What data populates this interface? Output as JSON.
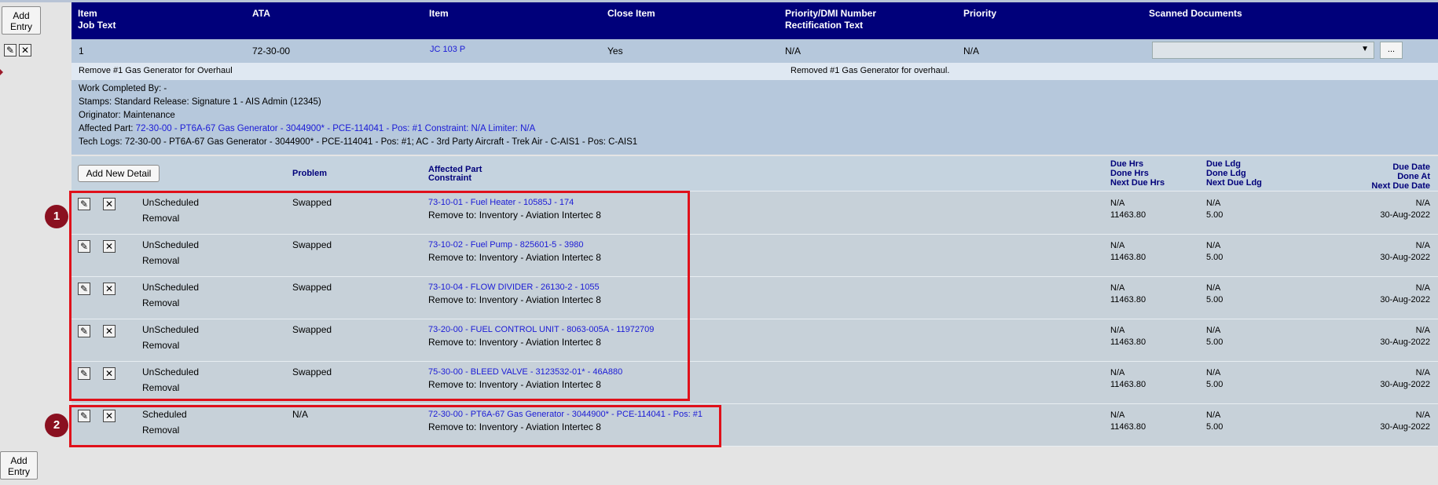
{
  "buttons": {
    "add_entry": "Add Entry",
    "add_new_detail": "Add New Detail",
    "more": "..."
  },
  "header": {
    "item": "Item",
    "job_text": "Job Text",
    "ata": "ATA",
    "item2": "Item",
    "close_item": "Close Item",
    "priority_dmi": "Priority/DMI Number",
    "rectification": "Rectification Text",
    "priority": "Priority",
    "scanned_docs": "Scanned Documents"
  },
  "item": {
    "number": "1",
    "ata": "72-30-00",
    "item_link": "JC 103 P",
    "close_item": "Yes",
    "priority_dmi": "N/A",
    "priority": "N/A",
    "job_text": "Remove #1 Gas Generator for Overhaul",
    "rectification_text": "Removed #1 Gas Generator for overhaul.",
    "work_completed": "Work Completed By: -",
    "stamps": "Stamps: Standard Release: Signature 1 - AIS Admin (12345)",
    "originator": "Originator: Maintenance",
    "affected_part_label": "Affected Part:",
    "affected_part_value": "72-30-00 - PT6A-67 Gas Generator - 3044900* - PCE-114041 - Pos: #1 Constraint: N/A Limiter: N/A",
    "tech_logs": "Tech Logs: 72-30-00 - PT6A-67 Gas Generator - 3044900* - PCE-114041 - Pos: #1; AC - 3rd Party Aircraft - Trek Air - C-AIS1 - Pos: C-AIS1"
  },
  "detail_header": {
    "problem": "Problem",
    "affected_part": "Affected Part",
    "constraint": "Constraint",
    "due_hrs": "Due Hrs",
    "done_hrs": "Done Hrs",
    "next_due_hrs": "Next Due Hrs",
    "due_ldg": "Due Ldg",
    "done_ldg": "Done Ldg",
    "next_due_ldg": "Next Due Ldg",
    "due_date": "Due Date",
    "done_at": "Done At",
    "next_due_date": "Next Due Date"
  },
  "details": [
    {
      "type": "UnScheduled",
      "action": "Removal",
      "problem": "Swapped",
      "part": "73-10-01 - Fuel Heater - 10585J - 174",
      "remove_to": "Remove to: Inventory - Aviation Intertec 8",
      "due_hrs": "N/A",
      "done_hrs": "11463.80",
      "due_ldg": "N/A",
      "done_ldg": "5.00",
      "due_date": "N/A",
      "done_at": "30-Aug-2022"
    },
    {
      "type": "UnScheduled",
      "action": "Removal",
      "problem": "Swapped",
      "part": "73-10-02 - Fuel Pump - 825601-5 - 3980",
      "remove_to": "Remove to: Inventory - Aviation Intertec 8",
      "due_hrs": "N/A",
      "done_hrs": "11463.80",
      "due_ldg": "N/A",
      "done_ldg": "5.00",
      "due_date": "N/A",
      "done_at": "30-Aug-2022"
    },
    {
      "type": "UnScheduled",
      "action": "Removal",
      "problem": "Swapped",
      "part": "73-10-04 - FLOW DIVIDER - 26130-2 - 1055",
      "remove_to": "Remove to: Inventory - Aviation Intertec 8",
      "due_hrs": "N/A",
      "done_hrs": "11463.80",
      "due_ldg": "N/A",
      "done_ldg": "5.00",
      "due_date": "N/A",
      "done_at": "30-Aug-2022"
    },
    {
      "type": "UnScheduled",
      "action": "Removal",
      "problem": "Swapped",
      "part": "73-20-00 - FUEL CONTROL UNIT - 8063-005A - 11972709",
      "remove_to": "Remove to: Inventory - Aviation Intertec 8",
      "due_hrs": "N/A",
      "done_hrs": "11463.80",
      "due_ldg": "N/A",
      "done_ldg": "5.00",
      "due_date": "N/A",
      "done_at": "30-Aug-2022"
    },
    {
      "type": "UnScheduled",
      "action": "Removal",
      "problem": "Swapped",
      "part": "75-30-00 - BLEED VALVE - 3123532-01* - 46A880",
      "remove_to": "Remove to: Inventory - Aviation Intertec 8",
      "due_hrs": "N/A",
      "done_hrs": "11463.80",
      "due_ldg": "N/A",
      "done_ldg": "5.00",
      "due_date": "N/A",
      "done_at": "30-Aug-2022"
    },
    {
      "type": "Scheduled",
      "action": "Removal",
      "problem": "N/A",
      "part": "72-30-00 - PT6A-67 Gas Generator - 3044900* - PCE-114041 - Pos: #1",
      "remove_to": "Remove to: Inventory - Aviation Intertec 8",
      "due_hrs": "N/A",
      "done_hrs": "11463.80",
      "due_ldg": "N/A",
      "done_ldg": "5.00",
      "due_date": "N/A",
      "done_at": "30-Aug-2022"
    }
  ],
  "annotations": {
    "badge1": "1",
    "badge2": "2"
  },
  "icons": {
    "edit": "edit-icon",
    "delete": "close-icon"
  },
  "colors": {
    "header_bg": "#00007a",
    "link": "#1a1ad6",
    "highlight": "#e0101a",
    "badge": "#8a1020"
  }
}
